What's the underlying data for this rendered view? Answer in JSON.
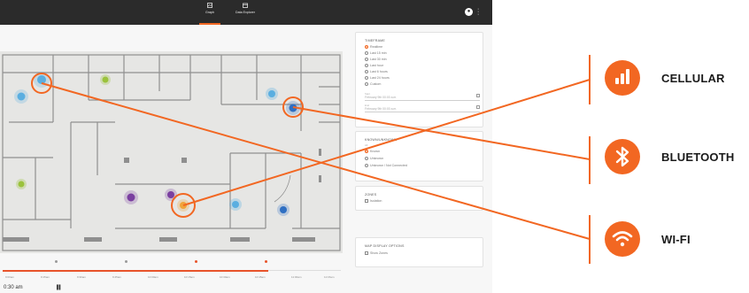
{
  "top_nav": {
    "tabs": [
      {
        "label": "Graph",
        "icon": "map-icon"
      },
      {
        "label": "Data Explorer",
        "icon": "calendar-icon"
      }
    ],
    "active_tab": 0,
    "account_icon": "account-icon",
    "menu_icon": "kebab-menu-icon"
  },
  "filters": {
    "timeframe": {
      "title": "TIMEFRAME",
      "options": [
        "Realtime",
        "Last 15 min",
        "Last 30 min",
        "Last hour",
        "Last 6 hours",
        "Last 24 hours",
        "Custom"
      ],
      "selected": 0,
      "start": {
        "label": "Start",
        "value": "February 9th 00:00 a.m."
      },
      "end": {
        "label": "End",
        "value": "February 9th 00:00 a.m."
      }
    },
    "known_status": {
      "title": "KNOWN/UNKNOWN",
      "options": [
        "Known",
        "Unknown",
        "Unknown / Not Connected"
      ],
      "selected": 0,
      "all_label": "All"
    },
    "zones": {
      "title": "ZONES",
      "options": [
        "Isolation"
      ]
    },
    "map_display": {
      "title": "MAP DISPLAY OPTIONS",
      "options": [
        "Show Zones"
      ]
    }
  },
  "timeline": {
    "ticks": [
      "9:00am",
      "9:15am",
      "9:30am",
      "9:45am",
      "10:00am",
      "10:15am",
      "10:30am",
      "10:45am",
      "11:00am",
      "11:15am"
    ],
    "current_time": "0:30 am",
    "pause_icon": "pause-icon"
  },
  "legend": [
    {
      "label": "CELLULAR",
      "icon": "cellular-signal-icon"
    },
    {
      "label": "BLUETOOTH",
      "icon": "bluetooth-icon"
    },
    {
      "label": "WI-FI",
      "icon": "wifi-icon"
    }
  ],
  "colors": {
    "accent": "#f26722",
    "topbar": "#2b2b2b",
    "device_wifi": "#7a3fa0",
    "device_bluetooth": "#2f6fc2",
    "device_cellular": "#f0a43a",
    "device_other": "#9bc23c",
    "device_info": "#5aaee0"
  }
}
